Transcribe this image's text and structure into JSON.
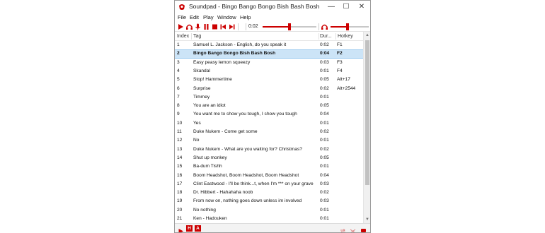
{
  "window": {
    "title": "Soundpad - Bingo Bango Bongo Bish Bash Bosh",
    "icon": "soundpad-logo-icon",
    "accent": "#cc0000",
    "controls": {
      "minimize": "—",
      "maximize": "☐",
      "close": "✕"
    }
  },
  "menu": [
    "File",
    "Edit",
    "Play",
    "Window",
    "Help"
  ],
  "toolbar": {
    "icons": [
      "play-icon",
      "headphones-icon",
      "microphone-icon",
      "pause-icon",
      "stop-icon",
      "previous-icon",
      "next-icon"
    ],
    "time": "0:02",
    "progress": 0.5,
    "volume": 0.45
  },
  "columns": {
    "index": "Index",
    "tag": "Tag",
    "duration": "Dur...",
    "hotkey": "Hotkey"
  },
  "selected_index": 1,
  "rows": [
    {
      "index": "1",
      "tag": "Samuel L. Jackson - English, do you speak it",
      "duration": "0:02",
      "hotkey": "F1"
    },
    {
      "index": "2",
      "tag": "Bingo Bango Bongo Bish Bash Bosh",
      "duration": "0:04",
      "hotkey": "F2"
    },
    {
      "index": "3",
      "tag": "Easy peasy lemon squeezy",
      "duration": "0:03",
      "hotkey": "F3"
    },
    {
      "index": "4",
      "tag": "Skandal",
      "duration": "0:01",
      "hotkey": "F4"
    },
    {
      "index": "5",
      "tag": "Stop! Hammertime",
      "duration": "0:05",
      "hotkey": "Alt+17"
    },
    {
      "index": "6",
      "tag": "Surprise",
      "duration": "0:02",
      "hotkey": "Alt+2544"
    },
    {
      "index": "7",
      "tag": "Timmey",
      "duration": "0:01",
      "hotkey": ""
    },
    {
      "index": "8",
      "tag": "You are an idiot",
      "duration": "0:05",
      "hotkey": ""
    },
    {
      "index": "9",
      "tag": "You want me to show you tough, I show you tough",
      "duration": "0:04",
      "hotkey": ""
    },
    {
      "index": "10",
      "tag": "Yes",
      "duration": "0:01",
      "hotkey": ""
    },
    {
      "index": "11",
      "tag": "Duke Nukem - Come get some",
      "duration": "0:02",
      "hotkey": ""
    },
    {
      "index": "12",
      "tag": "No",
      "duration": "0:01",
      "hotkey": ""
    },
    {
      "index": "13",
      "tag": "Duke Nukem - What are you waiting for? Christmas?",
      "duration": "0:02",
      "hotkey": ""
    },
    {
      "index": "14",
      "tag": "Shut up monkey",
      "duration": "0:05",
      "hotkey": ""
    },
    {
      "index": "15",
      "tag": "Ba-dum Tishh",
      "duration": "0:01",
      "hotkey": ""
    },
    {
      "index": "16",
      "tag": "Boom Headshot, Boom Headshot, Boom Headshot",
      "duration": "0:04",
      "hotkey": ""
    },
    {
      "index": "17",
      "tag": "Clint Eastwood - I'll be think...t, when I'm *** on your grave",
      "duration": "0:03",
      "hotkey": ""
    },
    {
      "index": "18",
      "tag": "Dr. Hibbert - Hahahaha noob",
      "duration": "0:02",
      "hotkey": ""
    },
    {
      "index": "19",
      "tag": "From now on, nothing goes down unless im involved",
      "duration": "0:03",
      "hotkey": ""
    },
    {
      "index": "20",
      "tag": "No nothing",
      "duration": "0:01",
      "hotkey": ""
    },
    {
      "index": "21",
      "tag": "Ken - Hadouken",
      "duration": "0:01",
      "hotkey": ""
    }
  ],
  "statusbar": {
    "icons": [
      "play-small-icon",
      "h-badge-icon",
      "a-badge-icon",
      "repeat-icon",
      "shuffle-icon",
      "chat-icon"
    ],
    "h_label": "H",
    "a_label": "A"
  }
}
